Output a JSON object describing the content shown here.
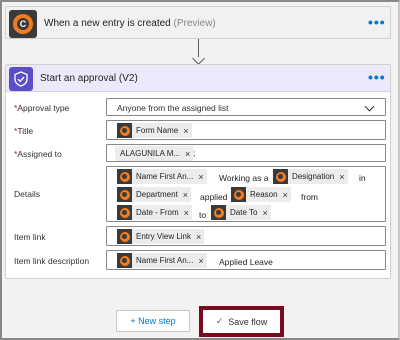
{
  "trigger": {
    "title": "When a new entry is created",
    "preview": "(Preview)",
    "menu": "•••"
  },
  "action": {
    "title": "Start an approval (V2)",
    "menu": "•••",
    "fields": {
      "approval_type": {
        "required": "*",
        "label": "Approval type",
        "value": "Anyone from the assigned list"
      },
      "title": {
        "required": "*",
        "label": "Title",
        "tokens": [
          "Form Name"
        ]
      },
      "assigned_to": {
        "required": "*",
        "label": "Assigned to",
        "tokens": [
          "ALAGUNILA M..."
        ],
        "suffix": ";"
      },
      "details": {
        "label": "Details",
        "parts": {
          "t1": "Name First An...",
          "p1": "Working as a",
          "t2": "Designation",
          "p2": "in",
          "t3": "Department",
          "p3": "applied",
          "t4": "Reason",
          "p4": "from",
          "t5": "Date - From",
          "p5": "to",
          "t6": "Date To"
        }
      },
      "item_link": {
        "label": "Item link",
        "tokens": [
          "Entry View Link"
        ]
      },
      "item_link_description": {
        "label": "Item link description",
        "tokens": [
          "Name First An..."
        ],
        "text": "Applied Leave"
      }
    }
  },
  "buttons": {
    "new_step": "+ New step",
    "save_flow": "Save flow",
    "save_check": "✓"
  },
  "token_close": "×",
  "colors": {
    "accent": "#0078d4",
    "approval_icon": "#5b4fc9",
    "app_orange": "#f47b20",
    "highlight": "#7c0a1e"
  }
}
